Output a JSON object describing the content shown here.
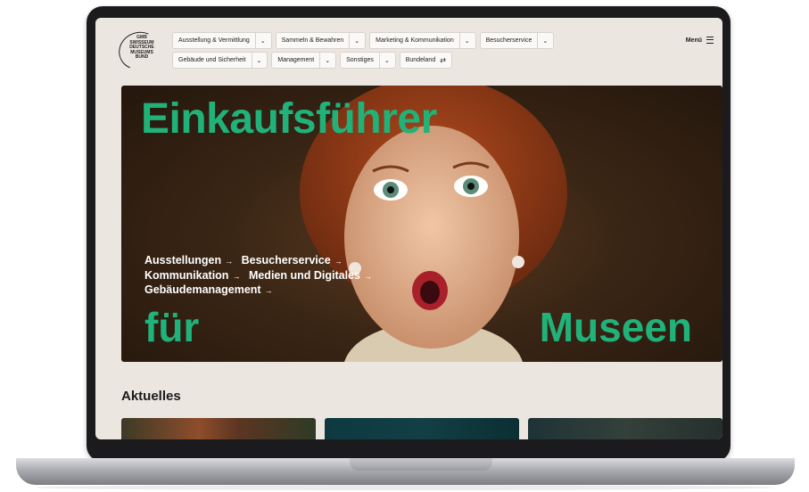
{
  "logo": {
    "lines": [
      "GMB",
      "SWISSEUM",
      "DEUTSCHE",
      "MUSEUMS",
      "BUND"
    ]
  },
  "nav": {
    "row1": [
      {
        "label": "Ausstellung & Vermittlung",
        "icon": "chevron-down-icon"
      },
      {
        "label": "Sammeln & Bewahren",
        "icon": "chevron-down-icon"
      },
      {
        "label": "Marketing & Kommunikation",
        "icon": "chevron-down-icon"
      },
      {
        "label": "Besucherservice",
        "icon": "chevron-down-icon"
      }
    ],
    "row2": [
      {
        "label": "Gebäude und Sicherheit",
        "icon": "chevron-down-icon"
      },
      {
        "label": "Management",
        "icon": "chevron-down-icon"
      },
      {
        "label": "Sonstiges",
        "icon": "chevron-down-icon"
      },
      {
        "label": "Bundeland",
        "icon": "swap-arrows-icon"
      }
    ],
    "menu_label": "Menü",
    "menu_icon": "hamburger-icon"
  },
  "hero": {
    "title": "Einkaufsführer",
    "word_left": "für",
    "word_right": "Museen",
    "links": [
      "Ausstellungen",
      "Besucherservice",
      "Kommunikation",
      "Medien und Digitales",
      "Gebäudemanagement"
    ],
    "link_arrow": "→",
    "accent_color": "#21b27a"
  },
  "news": {
    "title": "Aktuelles"
  },
  "colors": {
    "page_background": "#ece6e1",
    "accent": "#21b27a",
    "text": "#1a1a1a"
  }
}
